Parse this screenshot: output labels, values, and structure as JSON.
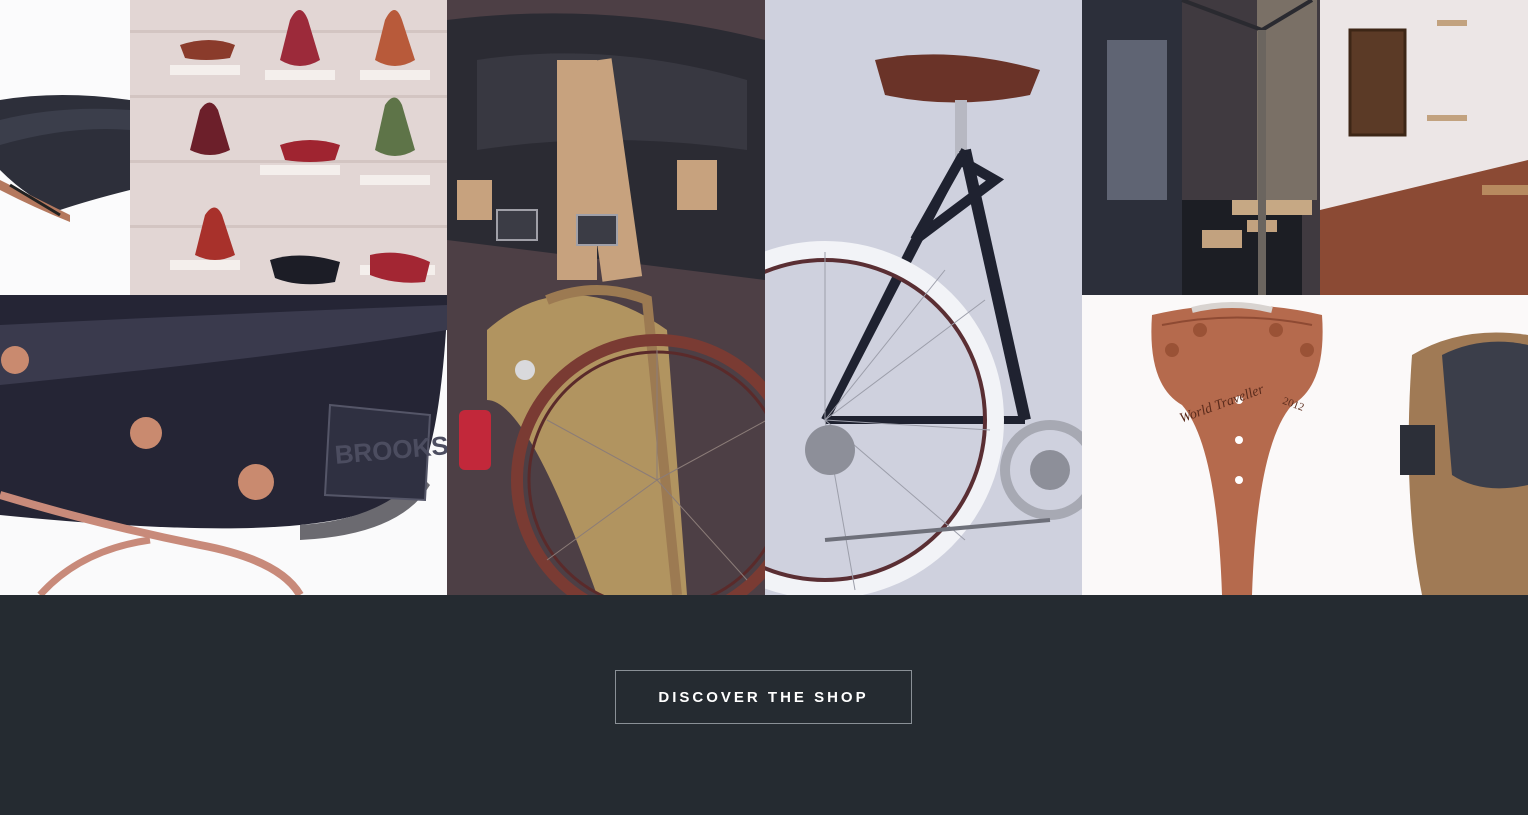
{
  "gallery": {
    "images": [
      {
        "name": "saddle-closeup-top"
      },
      {
        "name": "saddle-display-wall"
      },
      {
        "name": "black-saddle-closeup"
      },
      {
        "name": "bike-rear-with-bag"
      },
      {
        "name": "road-bicycle"
      },
      {
        "name": "store-interior"
      },
      {
        "name": "copper-saddle-world-traveller"
      }
    ],
    "saddle_brand_text": "BROOKS",
    "saddle_engraving": "World Traveller",
    "saddle_year": "2012"
  },
  "cta": {
    "label": "DISCOVER THE SHOP"
  },
  "colors": {
    "page_background": "#252b31",
    "button_border": "#8a9096",
    "button_text": "#ffffff"
  }
}
